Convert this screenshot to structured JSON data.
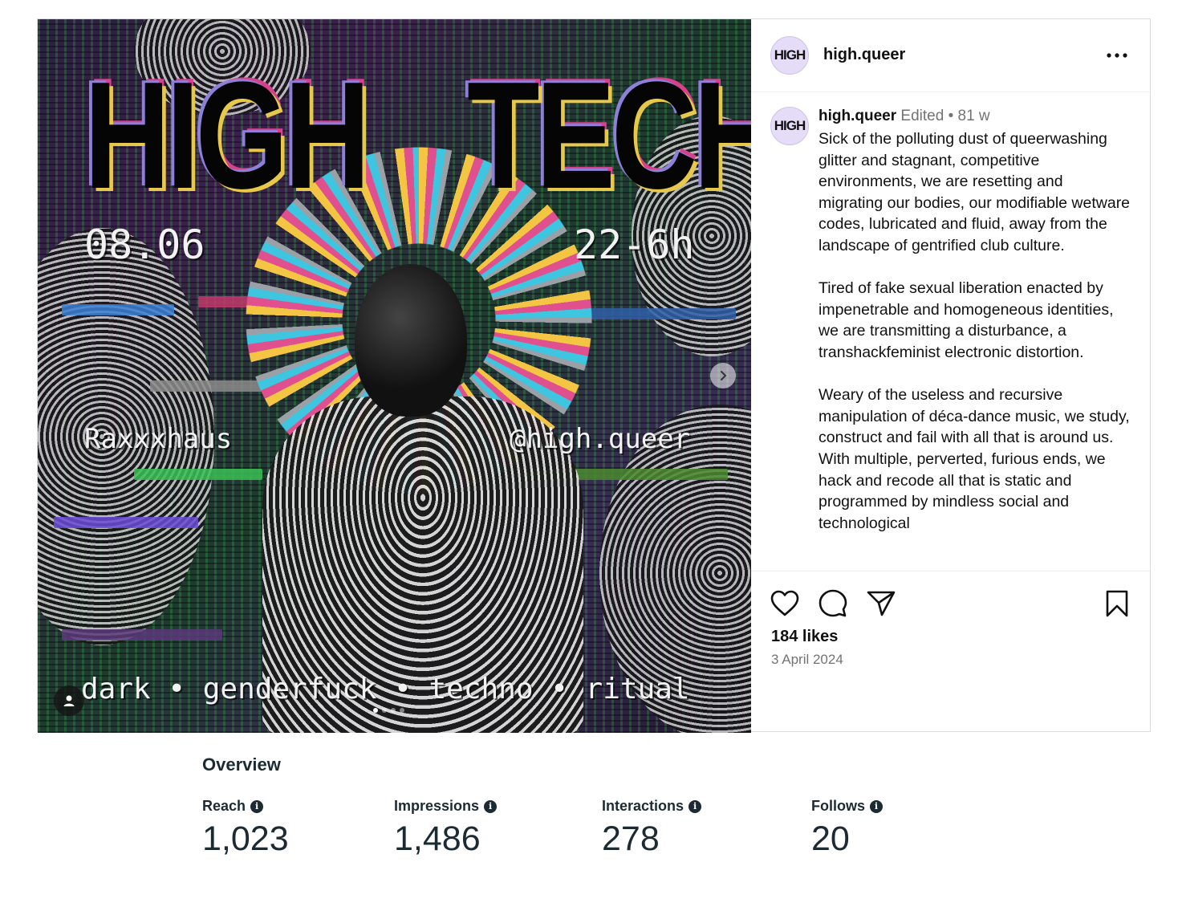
{
  "post": {
    "image": {
      "title_left": "HIGH",
      "title_right": "TECH",
      "date": "08.06",
      "time": "22-6h",
      "venue": "Raxxxhaus",
      "handle": "@high.queer",
      "tags": "dark • genderfuck • techno • ritual",
      "carousel_dots": 4,
      "active_dot": 1
    },
    "header": {
      "avatar_text": "HIGH",
      "username": "high.queer",
      "more_icon": "more-horizontal-icon"
    },
    "caption": {
      "avatar_text": "HIGH",
      "username": "high.queer",
      "edited": "Edited",
      "separator": "•",
      "age": "81 w",
      "paragraph_1": "Sick of the polluting dust of queerwashing glitter and stagnant, competitive environments, we are resetting and migrating our bodies, our modifiable wetware codes, lubricated and fluid, away from the landscape of gentrified club culture.",
      "paragraph_2": "Tired of fake sexual liberation enacted by impenetrable and homogeneous identities, we are transmitting a disturbance, a transhackfeminist electronic distortion.",
      "paragraph_3": "Weary of the useless and recursive manipulation of déca-dance music, we study, construct and fail with all that is around us. With multiple, perverted, furious ends, we hack and recode all that is static and programmed by mindless social and technological"
    },
    "actions": {
      "likes": "184 likes",
      "date": "3 April 2024",
      "icons": [
        "heart-icon",
        "comment-icon",
        "share-icon",
        "bookmark-icon"
      ]
    }
  },
  "insights": {
    "title": "Overview",
    "metrics": [
      {
        "label": "Reach",
        "value": "1,023"
      },
      {
        "label": "Impressions",
        "value": "1,486"
      },
      {
        "label": "Interactions",
        "value": "278"
      },
      {
        "label": "Follows",
        "value": "20"
      }
    ]
  },
  "colors": {
    "avatar_bg": "#e5dcf7",
    "muted_text": "#737373",
    "insights_text": "#1c2b33"
  }
}
